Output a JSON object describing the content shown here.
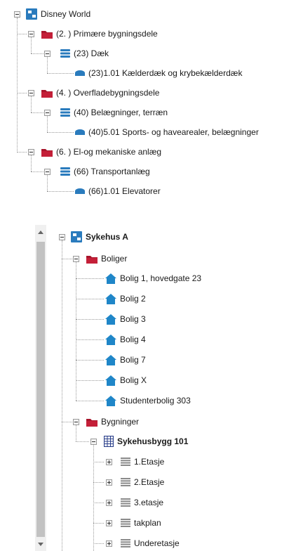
{
  "tree1": {
    "root": "Disney World",
    "groups": [
      {
        "label": "(2. ) Primære bygningsdele",
        "sub": "(23) Dæk",
        "leaf": "(23)1.01 Kælderdæk og krybekælderdæk"
      },
      {
        "label": "(4. ) Overfladebygningsdele",
        "sub": "(40) Belægninger, terræn",
        "leaf": "(40)5.01 Sports- og havearealer, belægninger"
      },
      {
        "label": "(6. ) El-og mekaniske anlæg",
        "sub": "(66) Transportanlæg",
        "leaf": "(66)1.01 Elevatorer"
      }
    ]
  },
  "tree2": {
    "root": "Sykehus A",
    "boliger": {
      "label": "Boliger",
      "items": [
        "Bolig 1, hovedgate 23",
        "Bolig 2",
        "Bolig 3",
        "Bolig 4",
        "Bolig 7",
        "Bolig X",
        "Studenterbolig 303"
      ]
    },
    "bygninger": {
      "label": "Bygninger",
      "building": "Sykehusbygg 101",
      "floors": [
        "1.Etasje",
        "2.Etasje",
        "3.etasje",
        "takplan",
        "Underetasje"
      ]
    }
  },
  "colors": {
    "folder": "#a8152b",
    "root_icon": "#2a7bbd",
    "db_icon": "#2a7bbd",
    "house_icon": "#1f86c8",
    "floor_icon": "#8a8a8a"
  }
}
